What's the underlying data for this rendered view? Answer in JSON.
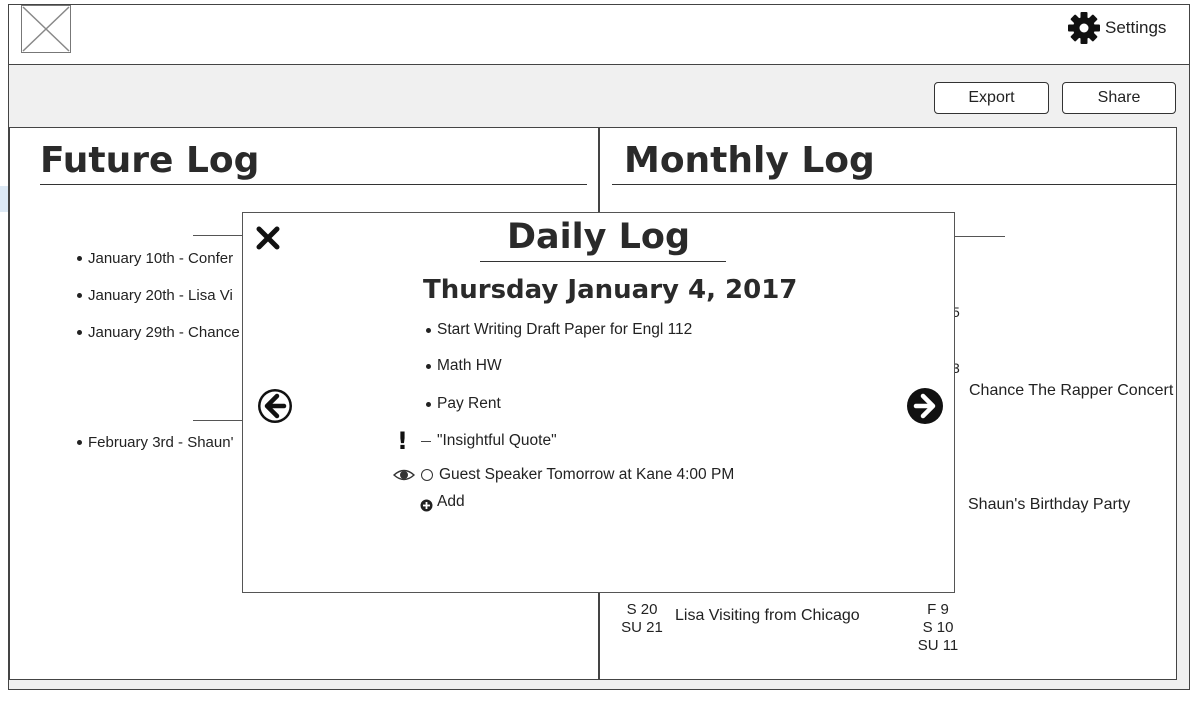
{
  "header": {
    "logo_icon": "image-placeholder-icon",
    "settings_icon": "gear-icon",
    "settings_label": "Settings"
  },
  "toolbar": {
    "export_label": "Export",
    "share_label": "Share"
  },
  "future_log": {
    "title": "Future Log",
    "items": [
      {
        "text": "January 10th - Confer"
      },
      {
        "text": "January 20th - Lisa Vi"
      },
      {
        "text": "January 29th - Chance"
      },
      {
        "text": "February 3rd - Shaun'"
      }
    ]
  },
  "monthly_log": {
    "title": "Monthly Log",
    "event_right_1": "Chance The Rapper Concert",
    "event_right_2": "Shaun's Birthday Party",
    "event_left_bottom": "Lisa Visiting from Chicago",
    "days_left": [
      "S 20",
      "SU 21"
    ],
    "days_right": [
      "F 9",
      "S 10",
      "SU 11"
    ],
    "partial_digit_1": "5",
    "partial_digit_2": "3"
  },
  "daily_log": {
    "title": "Daily Log",
    "date": "Thursday January 4, 2017",
    "close_icon": "close-x-icon",
    "prev_icon": "arrow-left-circle-icon",
    "next_icon": "arrow-right-circle-icon",
    "entries": [
      {
        "type": "task",
        "text": "Start Writing Draft Paper for Engl 112"
      },
      {
        "type": "task",
        "text": "Math HW"
      },
      {
        "type": "task",
        "text": "Pay Rent"
      },
      {
        "type": "note",
        "signifier": "!",
        "text": "\"Insightful Quote\""
      },
      {
        "type": "event",
        "signifier_icon": "eye-icon",
        "text": "Guest Speaker Tomorrow at Kane 4:00 PM"
      }
    ],
    "add_label": "Add",
    "add_icon": "plus-circle-icon"
  }
}
